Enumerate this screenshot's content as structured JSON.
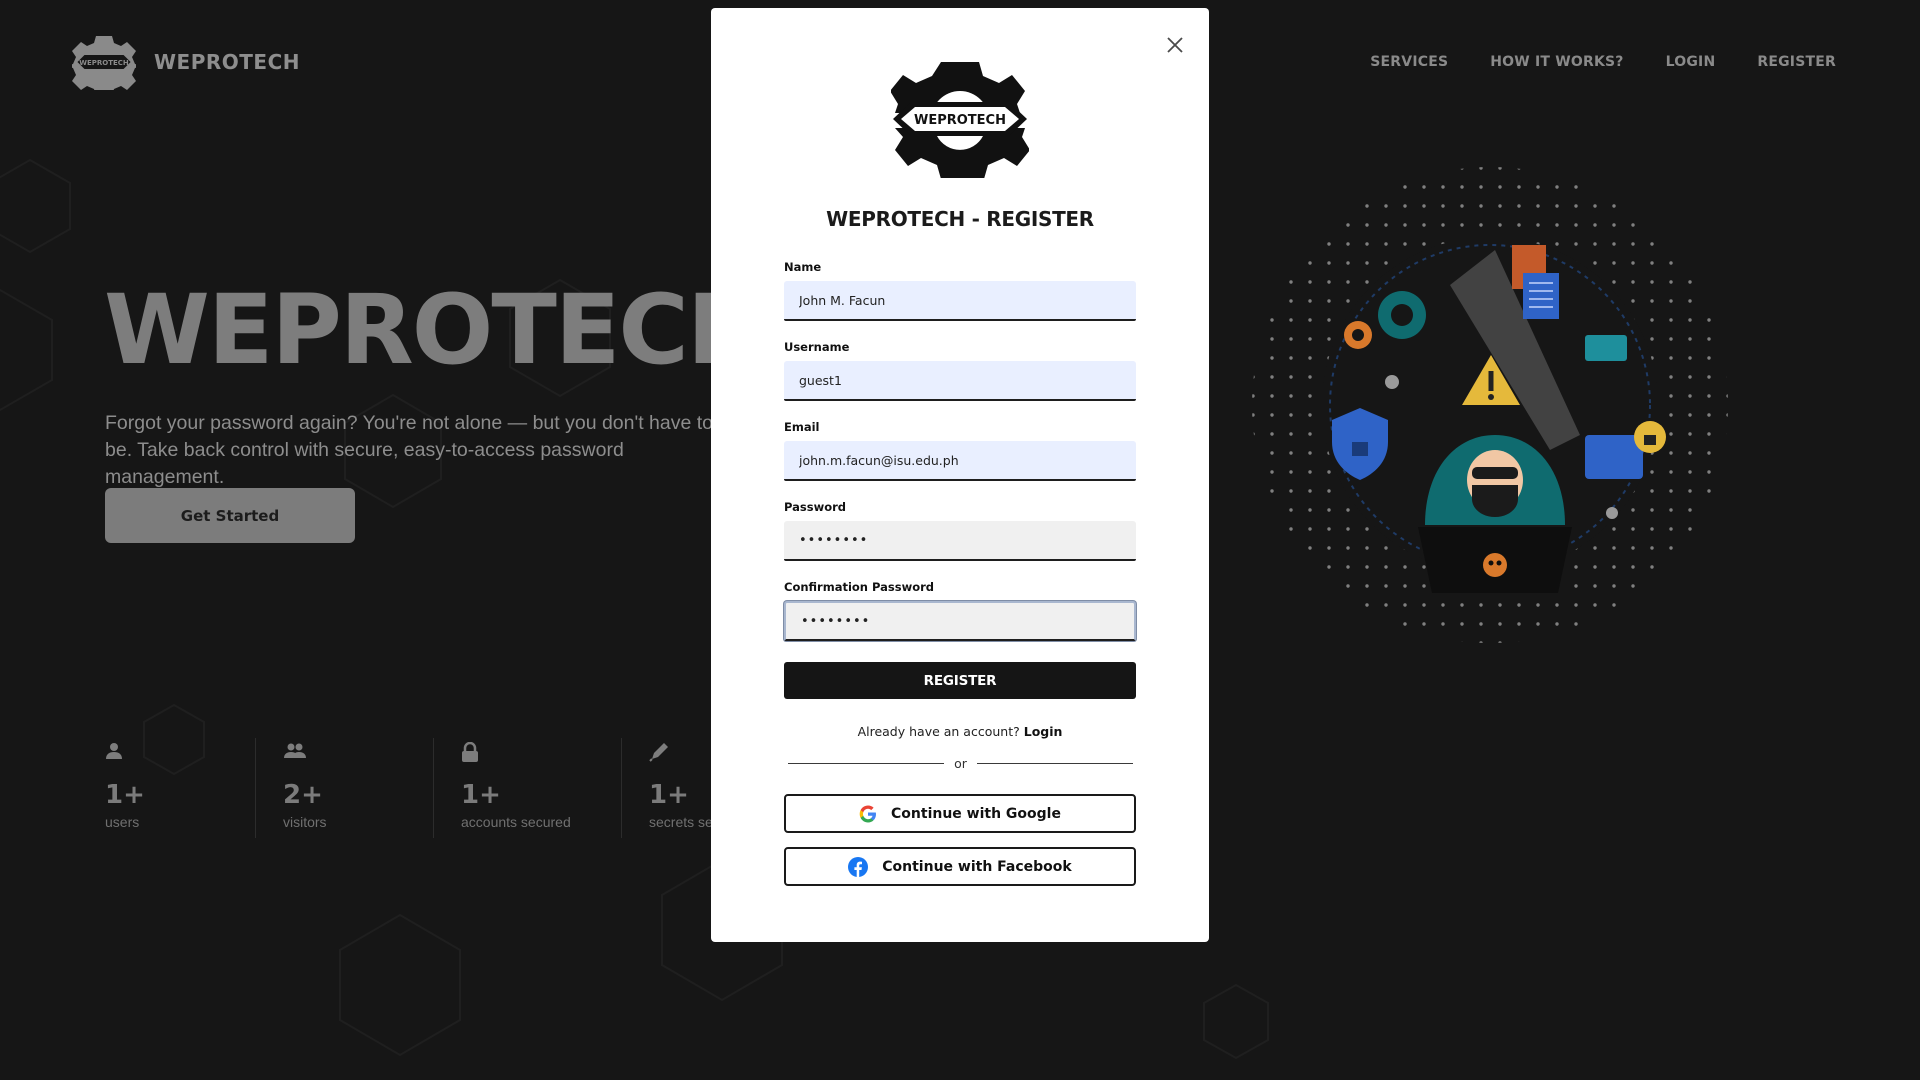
{
  "brand": {
    "name": "WEPROTECH",
    "logo_text": "WEPROTECH"
  },
  "nav": {
    "items": [
      "SERVICES",
      "HOW IT WORKS?",
      "LOGIN",
      "REGISTER"
    ]
  },
  "hero": {
    "title": "WEPROTECH",
    "text": "Forgot your password again? You're not alone — but you don't have to be. Take back control with secure, easy-to-access password management.",
    "cta": "Get Started"
  },
  "stats": [
    {
      "icon": "user-icon",
      "value": "1+",
      "label": "users"
    },
    {
      "icon": "users-icon",
      "value": "2+",
      "label": "visitors"
    },
    {
      "icon": "lock-icon",
      "value": "1+",
      "label": "accounts secured"
    },
    {
      "icon": "pen-icon",
      "value": "1+",
      "label": "secrets secured"
    }
  ],
  "modal": {
    "logo_text": "WEPROTECH",
    "title": "WEPROTECH - REGISTER",
    "fields": {
      "name": {
        "label": "Name",
        "value": "John M. Facun"
      },
      "username": {
        "label": "Username",
        "value": "guest1"
      },
      "email": {
        "label": "Email",
        "value": "john.m.facun@isu.edu.ph"
      },
      "password": {
        "label": "Password",
        "value": "••••••••"
      },
      "confirm": {
        "label": "Confirmation Password",
        "value": "••••••••"
      }
    },
    "register_label": "REGISTER",
    "login_prompt": "Already have an account?",
    "login_link": "Login",
    "or_text": "or",
    "google_label": "Continue with Google",
    "facebook_label": "Continue with Facebook"
  },
  "colors": {
    "background": "#161616",
    "modal": "#ffffff",
    "input_fill": "#e9efff",
    "primary_button": "#151515",
    "facebook": "#1877f2"
  }
}
